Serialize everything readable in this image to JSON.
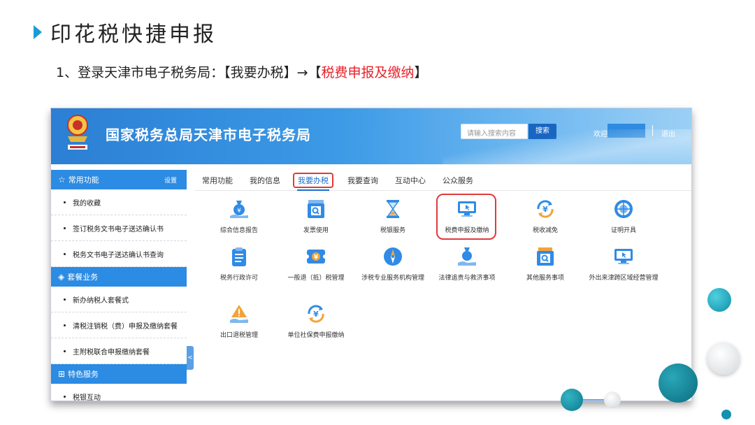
{
  "slide": {
    "title": "印花税快捷申报",
    "instruction_prefix": "1、登录天津市电子税务局：【我要办税】→【",
    "instruction_highlight": "税费申报及缴纳",
    "instruction_suffix": "】"
  },
  "portal": {
    "site_title": "国家税务总局天津市电子税务局",
    "search_placeholder": "请输入搜索内容",
    "search_button": "搜索",
    "welcome": "欢迎,",
    "logout": "退出"
  },
  "sidebar": {
    "sections": [
      {
        "title": "常用功能",
        "icon": "star-icon",
        "action": "设置",
        "items": [
          "我的收藏",
          "签订税务文书电子送达确认书",
          "税务文书电子送达确认书查询"
        ]
      },
      {
        "title": "套餐业务",
        "icon": "layers-icon",
        "action": "",
        "items": [
          "新办纳税人套餐式",
          "清税注销税（费）申报及缴纳套餐",
          "主附税联合申报缴纳套餐"
        ]
      },
      {
        "title": "特色服务",
        "icon": "grid-icon",
        "action": "",
        "items": [
          "税银互动"
        ]
      }
    ],
    "collapse_glyph": "<"
  },
  "tabs": [
    "常用功能",
    "我的信息",
    "我要办税",
    "我要查询",
    "互动中心",
    "公众服务"
  ],
  "active_tab": "我要办税",
  "services": [
    {
      "label": "综合信息报告",
      "icon": "money-bag-icon"
    },
    {
      "label": "发票使用",
      "icon": "invoice-search-icon"
    },
    {
      "label": "税银服务",
      "icon": "hourglass-icon"
    },
    {
      "label": "税费申报及缴纳",
      "icon": "monitor-cursor-icon"
    },
    {
      "label": "税收减免",
      "icon": "yuan-cycle-icon"
    },
    {
      "label": "证明开具",
      "icon": "globe-certificate-icon"
    },
    {
      "label": "税务行政许可",
      "icon": "clipboard-icon"
    },
    {
      "label": "一般退（抵）税管理",
      "icon": "yuan-ticket-icon"
    },
    {
      "label": "涉税专业服务机构管理",
      "icon": "compass-icon"
    },
    {
      "label": "法律追责与救济事项",
      "icon": "hand-bag-icon"
    },
    {
      "label": "其他服务事项",
      "icon": "register-search-icon"
    },
    {
      "label": "外出来津跨区域经营管理",
      "icon": "monitor-cursor-icon"
    },
    {
      "label": "出口退税管理",
      "icon": "warning-hand-icon"
    },
    {
      "label": "单位社保费申报缴纳",
      "icon": "yuan-cycle-icon"
    }
  ],
  "colors": {
    "accent": "#1b9bd6",
    "highlight_red": "#e8222a",
    "banner_blue": "#2b7fd4",
    "icon_blue": "#2f8be6"
  }
}
